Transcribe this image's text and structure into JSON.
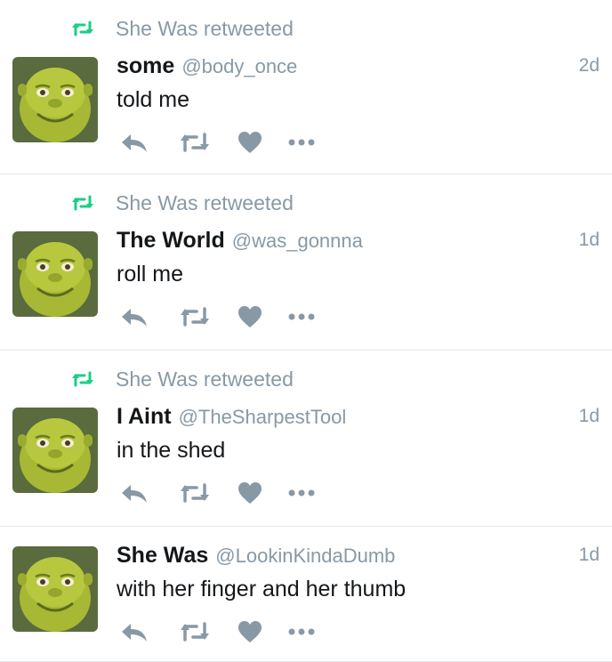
{
  "colors": {
    "retweet_green": "#19cf86",
    "muted": "#8899a6",
    "text": "#14171a",
    "divider": "#e1e8ed"
  },
  "tweets": [
    {
      "retweeted_by": "She Was retweeted",
      "name": "some",
      "handle": "@body_once",
      "time": "2d",
      "text": "told me"
    },
    {
      "retweeted_by": "She Was retweeted",
      "name": "The World",
      "handle": "@was_gonnna",
      "time": "1d",
      "text": "roll me"
    },
    {
      "retweeted_by": "She Was retweeted",
      "name": "I Aint",
      "handle": "@TheSharpestTool",
      "time": "1d",
      "text": "in the shed"
    },
    {
      "retweeted_by": "",
      "name": "She Was",
      "handle": "@LookinKindaDumb",
      "time": "1d",
      "text": "with her finger and her thumb"
    }
  ]
}
